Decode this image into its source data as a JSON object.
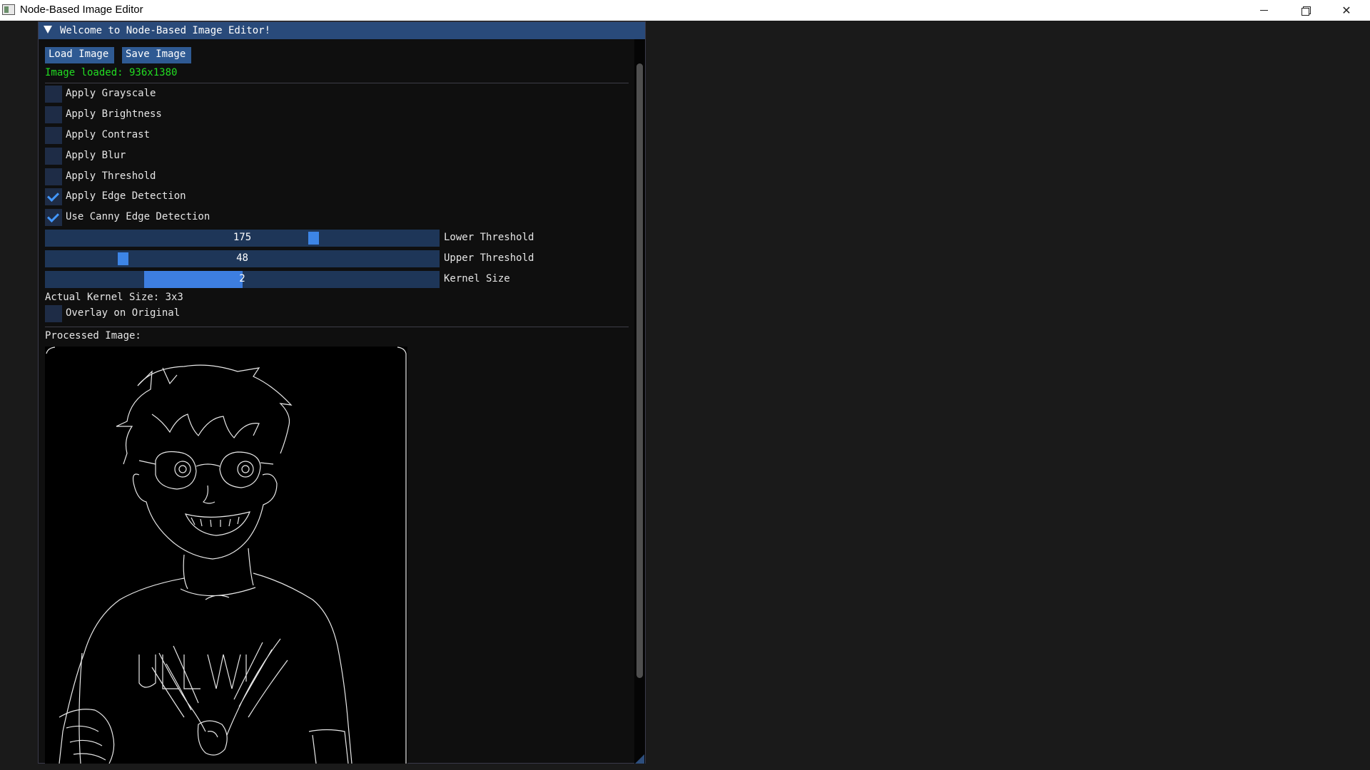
{
  "os_window": {
    "title": "Node-Based Image Editor"
  },
  "editor": {
    "title": "Welcome to Node-Based Image Editor!",
    "load_label": "Load Image",
    "save_label": "Save Image",
    "status": "Image loaded: 936x1380",
    "checkboxes": [
      {
        "label": "Apply Grayscale",
        "checked": false
      },
      {
        "label": "Apply Brightness",
        "checked": false
      },
      {
        "label": "Apply Contrast",
        "checked": false
      },
      {
        "label": "Apply Blur",
        "checked": false
      },
      {
        "label": "Apply Threshold",
        "checked": false
      },
      {
        "label": "Apply Edge Detection",
        "checked": true
      },
      {
        "label": "Use Canny Edge Detection",
        "checked": true
      }
    ],
    "sliders": [
      {
        "label": "Lower Threshold",
        "value": "175",
        "kind": "grab",
        "fraction": 0.686
      },
      {
        "label": "Upper Threshold",
        "value": "48",
        "kind": "grab",
        "fraction": 0.188
      },
      {
        "label": "Kernel Size",
        "value": "2",
        "kind": "fill",
        "fraction": 0.5
      }
    ],
    "kernel_info": "Actual Kernel Size: 3x3",
    "overlay": {
      "label": "Overlay on Original",
      "checked": false
    },
    "processed_label": "Processed Image:"
  },
  "colors": {
    "accent": "#4296fa",
    "titlebar_bg": "#294a7a",
    "status_text": "#22dd22",
    "window_bg": "#0f0f0f",
    "app_bg": "#1a1a1a"
  },
  "icons": [
    "app-icon",
    "minimize-icon",
    "maximize-icon",
    "close-icon",
    "collapse-arrow-icon",
    "checkmark-icon",
    "resize-grip-icon"
  ]
}
